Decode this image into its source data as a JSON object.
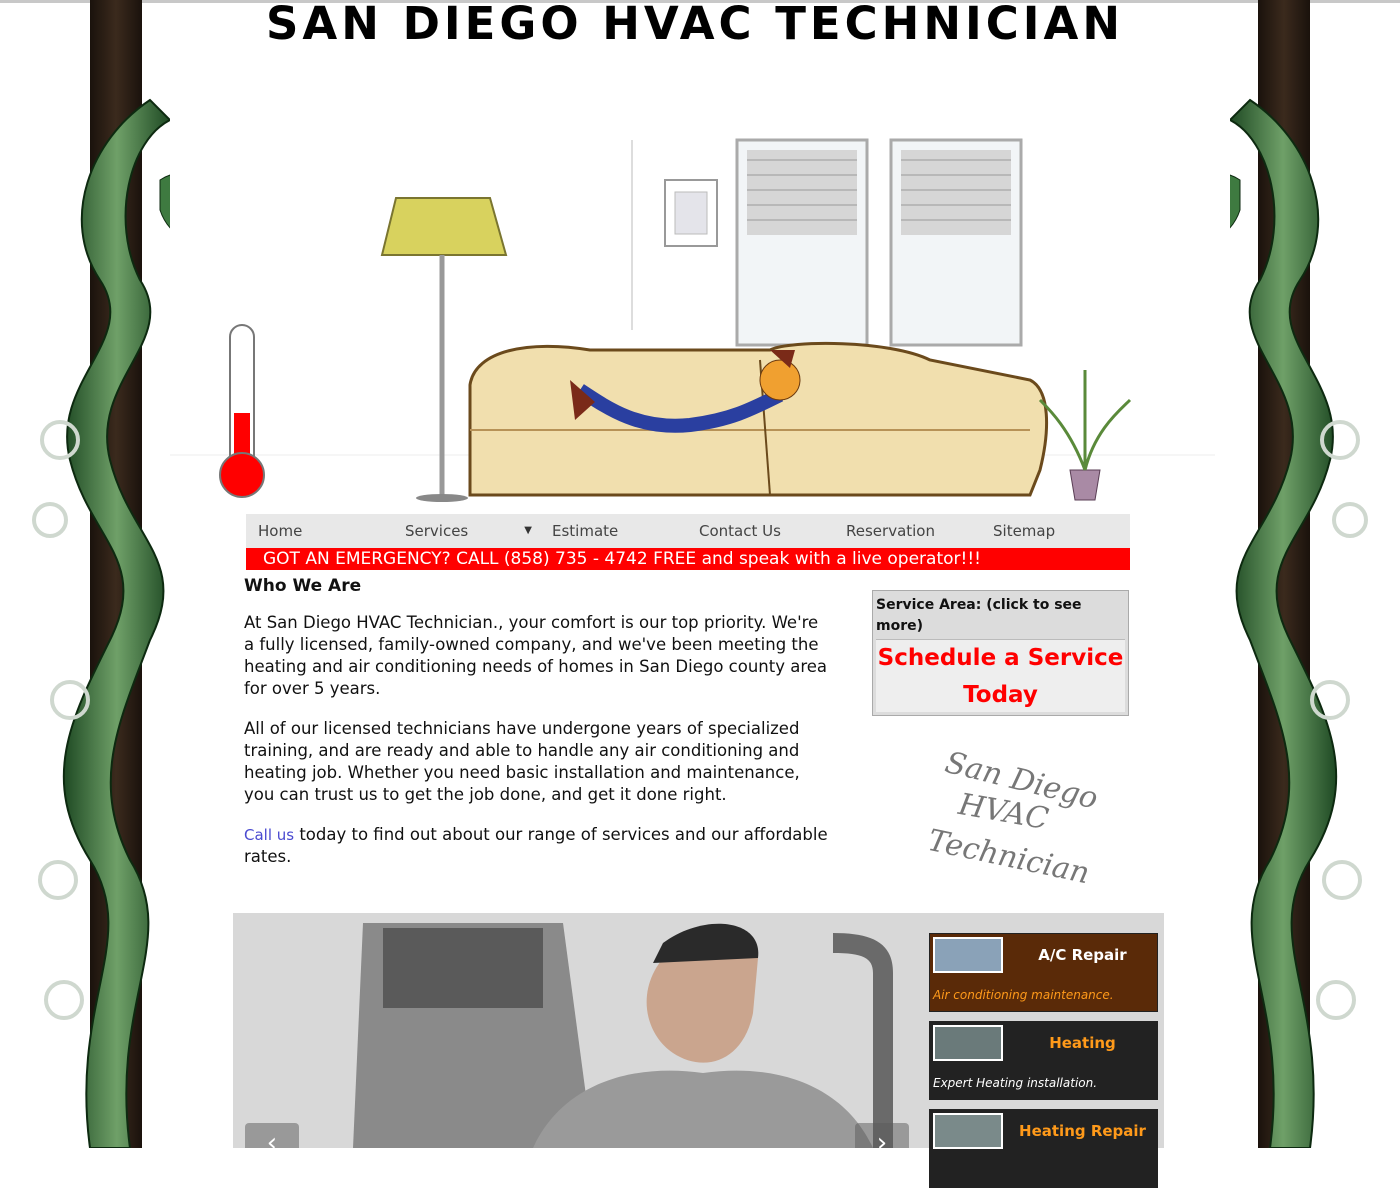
{
  "site": {
    "title": "SAN DIEGO HVAC TECHNICIAN",
    "logo_text": [
      "San Diego",
      "HVAC",
      "Technician"
    ]
  },
  "nav": {
    "items": [
      "Home",
      "Services",
      "Estimate",
      "Contact Us",
      "Reservation",
      "Sitemap"
    ],
    "dropdown_icon": "caret-down-icon"
  },
  "emergency": {
    "text": "GOT AN EMERGENCY? CALL (858) 735 - 4742 FREE and speak with a live operator!!!"
  },
  "about": {
    "heading": "Who We Are",
    "p1": "At San Diego HVAC Technician., your comfort is our top priority. We're a fully licensed, family-owned company, and we've been meeting the heating and air conditioning needs of homes in San Diego county area for over 5 years.",
    "p2": "All of our licensed technicians have undergone years of specialized training, and are ready and able to handle any air conditioning and heating job. Whether you need basic installation and maintenance, you can trust us to get the job done, and get it done right.",
    "p3_link": "Call us",
    "p3_rest": " today to find out about our range of services and our affordable rates."
  },
  "service_area": {
    "header": "Service Area:    (click to see more)",
    "cta": "Schedule a Service Today"
  },
  "services": [
    {
      "title": "A/C Repair",
      "desc": "Air conditioning maintenance."
    },
    {
      "title": "Heating",
      "desc": "Expert Heating installation."
    },
    {
      "title": "Heating Repair",
      "desc": ""
    }
  ],
  "colors": {
    "emergency_bar": "#ff0000",
    "cta_text": "#ff0000",
    "tile_ac_bg": "#5a2a08",
    "tile_heating_bg": "#222222",
    "tile_title_orange": "#ff9a1a",
    "link": "#4a4ad0"
  },
  "hero": {
    "thermometer_level": 0.45
  }
}
